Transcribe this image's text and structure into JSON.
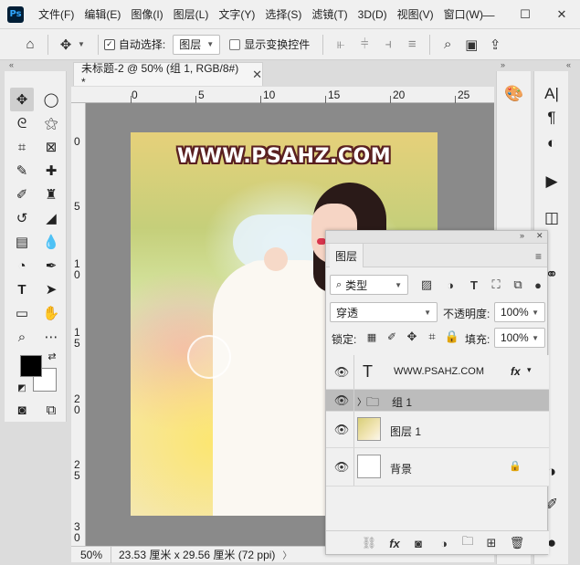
{
  "app": {
    "logo": "Ps"
  },
  "menu": [
    "文件(F)",
    "编辑(E)",
    "图像(I)",
    "图层(L)",
    "文字(Y)",
    "选择(S)",
    "滤镜(T)",
    "3D(D)",
    "视图(V)",
    "窗口(W)"
  ],
  "window_controls": {
    "minimize": "—",
    "maximize": "☐",
    "close": "✕"
  },
  "options": {
    "auto_select_label": "自动选择:",
    "auto_select_checked": true,
    "auto_select_target": "图层",
    "show_transform_label": "显示变换控件",
    "show_transform_checked": false
  },
  "document": {
    "tab_title": "未标题-2 @ 50% (组 1, RGB/8#) *",
    "tab_close": "✕",
    "ruler_top_labels": [
      "0",
      "5",
      "10",
      "15",
      "20",
      "25"
    ],
    "ruler_left_labels": [
      "0",
      "5",
      "1\n0",
      "1\n5",
      "2\n0",
      "2\n5",
      "3\n0"
    ],
    "watermark_text": "WWW.PSAHZ.COM"
  },
  "statusbar": {
    "zoom": "50%",
    "info": "23.53 厘米 x 29.56 厘米 (72 ppi)",
    "arrow": "〉"
  },
  "layers_panel": {
    "tab_label": "图层",
    "filter_kind": "类型",
    "blend_mode": "穿透",
    "opacity_label": "不透明度:",
    "opacity_value": "100%",
    "lock_label": "锁定:",
    "fill_label": "填充:",
    "fill_value": "100%",
    "layers": [
      {
        "name": "WWW.PSAHZ.COM",
        "kind": "text",
        "fx": "fx",
        "selected": false
      },
      {
        "name": "组 1",
        "kind": "group",
        "selected": true
      },
      {
        "name": "图层 1",
        "kind": "image",
        "selected": false
      },
      {
        "name": "背景",
        "kind": "background",
        "locked": true,
        "selected": false
      }
    ]
  },
  "colors": {
    "foreground": "#000000",
    "background": "#ffffff",
    "selected_row": "#bcbcbc",
    "canvas_bg": "#808080"
  }
}
